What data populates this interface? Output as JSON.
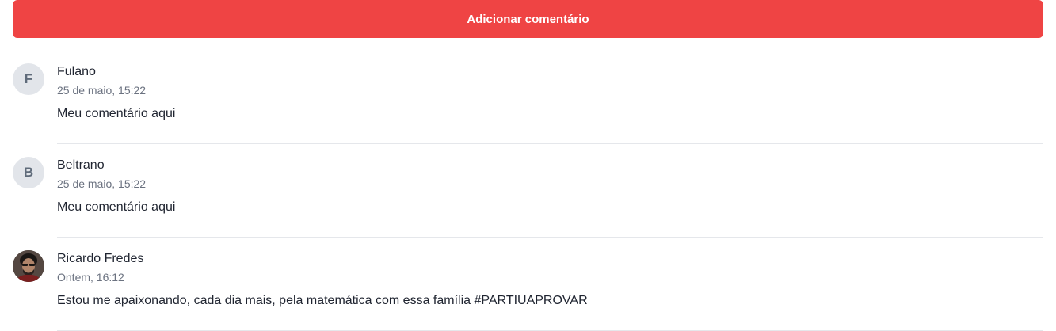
{
  "add_button": {
    "label": "Adicionar comentário"
  },
  "colors": {
    "accent": "#ef4444",
    "avatar_bg": "#e2e5ea"
  },
  "comments": [
    {
      "initial": "F",
      "name": "Fulano",
      "date": "25 de maio, 15:22",
      "text": "Meu comentário aqui"
    },
    {
      "initial": "B",
      "name": "Beltrano",
      "date": "25 de maio, 15:22",
      "text": "Meu comentário aqui"
    },
    {
      "avatar": "user-photo",
      "name": "Ricardo Fredes",
      "date": "Ontem, 16:12",
      "text": "Estou me apaixonando, cada dia mais, pela matemática com essa família #PARTIUAPROVAR"
    }
  ]
}
